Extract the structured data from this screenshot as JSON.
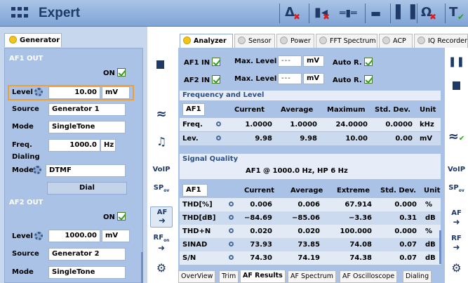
{
  "app": {
    "title": "Expert"
  },
  "toolbar": {
    "icons": [
      "delta-x-icon",
      "distortion-x-icon",
      "slider-icon",
      "folder-icon",
      "columns-icon",
      "ohm-icon",
      "tc-icon"
    ]
  },
  "left": {
    "tab_label": "Generator",
    "af1_out": "AF1 OUT",
    "on_label": "ON",
    "level_label": "Level",
    "level_value": "10.00",
    "level_unit": "mV",
    "source_label": "Source",
    "source_value": "Generator 1",
    "mode_label": "Mode",
    "mode_value": "SingleTone",
    "freq_label": "Freq.",
    "freq_value": "1000.0",
    "freq_unit": "Hz",
    "dialing_label": "Dialing",
    "dial_mode_label": "Mode",
    "dial_mode_value": "DTMF",
    "dial_button": "Dial",
    "af2_out": "AF2 OUT",
    "on2_label": "ON",
    "level2_label": "Level",
    "level2_value": "1000.00",
    "level2_unit": "mV",
    "source2_label": "Source",
    "source2_value": "Generator 2",
    "mode2_label": "Mode",
    "mode2_value": "SingleTone"
  },
  "sidebar_left": {
    "voip": "VoIP",
    "sp": "SP",
    "sp_sub": "ov",
    "af": "AF",
    "rf": "RF",
    "rf_sub": "on"
  },
  "sidebar_right": {
    "voip": "VoIP",
    "sp": "SP",
    "sp_sub": "ov",
    "af": "AF",
    "rf": "RF"
  },
  "tabs": [
    "Analyzer",
    "Sensor",
    "Power",
    "FFT Spectrum",
    "ACP",
    "IQ Recorder"
  ],
  "af_in": {
    "af1": "AF1 IN",
    "af2": "AF2 IN",
    "max_level": "Max. Level",
    "dash": "---",
    "unit": "mV",
    "auto_r": "Auto R."
  },
  "freq_level": {
    "header": "Frequency and Level",
    "selector": "AF1",
    "columns": [
      "Current",
      "Average",
      "Maximum",
      "Std. Dev.",
      "Unit"
    ],
    "rows": [
      {
        "label": "Freq.",
        "values": [
          "1.0000",
          "1.0000",
          "24.0000",
          "0.0000"
        ],
        "unit": "kHz"
      },
      {
        "label": "Lev.",
        "values": [
          "9.98",
          "9.98",
          "10.00",
          "0.00"
        ],
        "unit": "mV"
      }
    ]
  },
  "signal_quality": {
    "header": "Signal Quality",
    "info": "AF1 @ 1000.0 Hz, HP 6 Hz",
    "selector": "AF1",
    "columns": [
      "Current",
      "Average",
      "Extreme",
      "Std. Dev.",
      "Unit"
    ],
    "rows": [
      {
        "label": "THD[%]",
        "values": [
          "0.006",
          "0.006",
          "67.914",
          "0.000"
        ],
        "unit": "%"
      },
      {
        "label": "THD[dB]",
        "values": [
          "−84.69",
          "−85.06",
          "−3.36",
          "0.31"
        ],
        "unit": "dB"
      },
      {
        "label": "THD+N",
        "values": [
          "0.020",
          "0.020",
          "100.000",
          "0.000"
        ],
        "unit": "%"
      },
      {
        "label": "SINAD",
        "values": [
          "73.93",
          "73.85",
          "74.08",
          "0.07"
        ],
        "unit": "dB"
      },
      {
        "label": "S/N",
        "values": [
          "74.30",
          "74.19",
          "74.38",
          "0.07"
        ],
        "unit": "dB"
      }
    ]
  },
  "bottom_tabs": [
    "OverView",
    "Trim",
    "AF Results",
    "AF Spectrum",
    "AF Oscilloscope",
    "Dialing"
  ]
}
